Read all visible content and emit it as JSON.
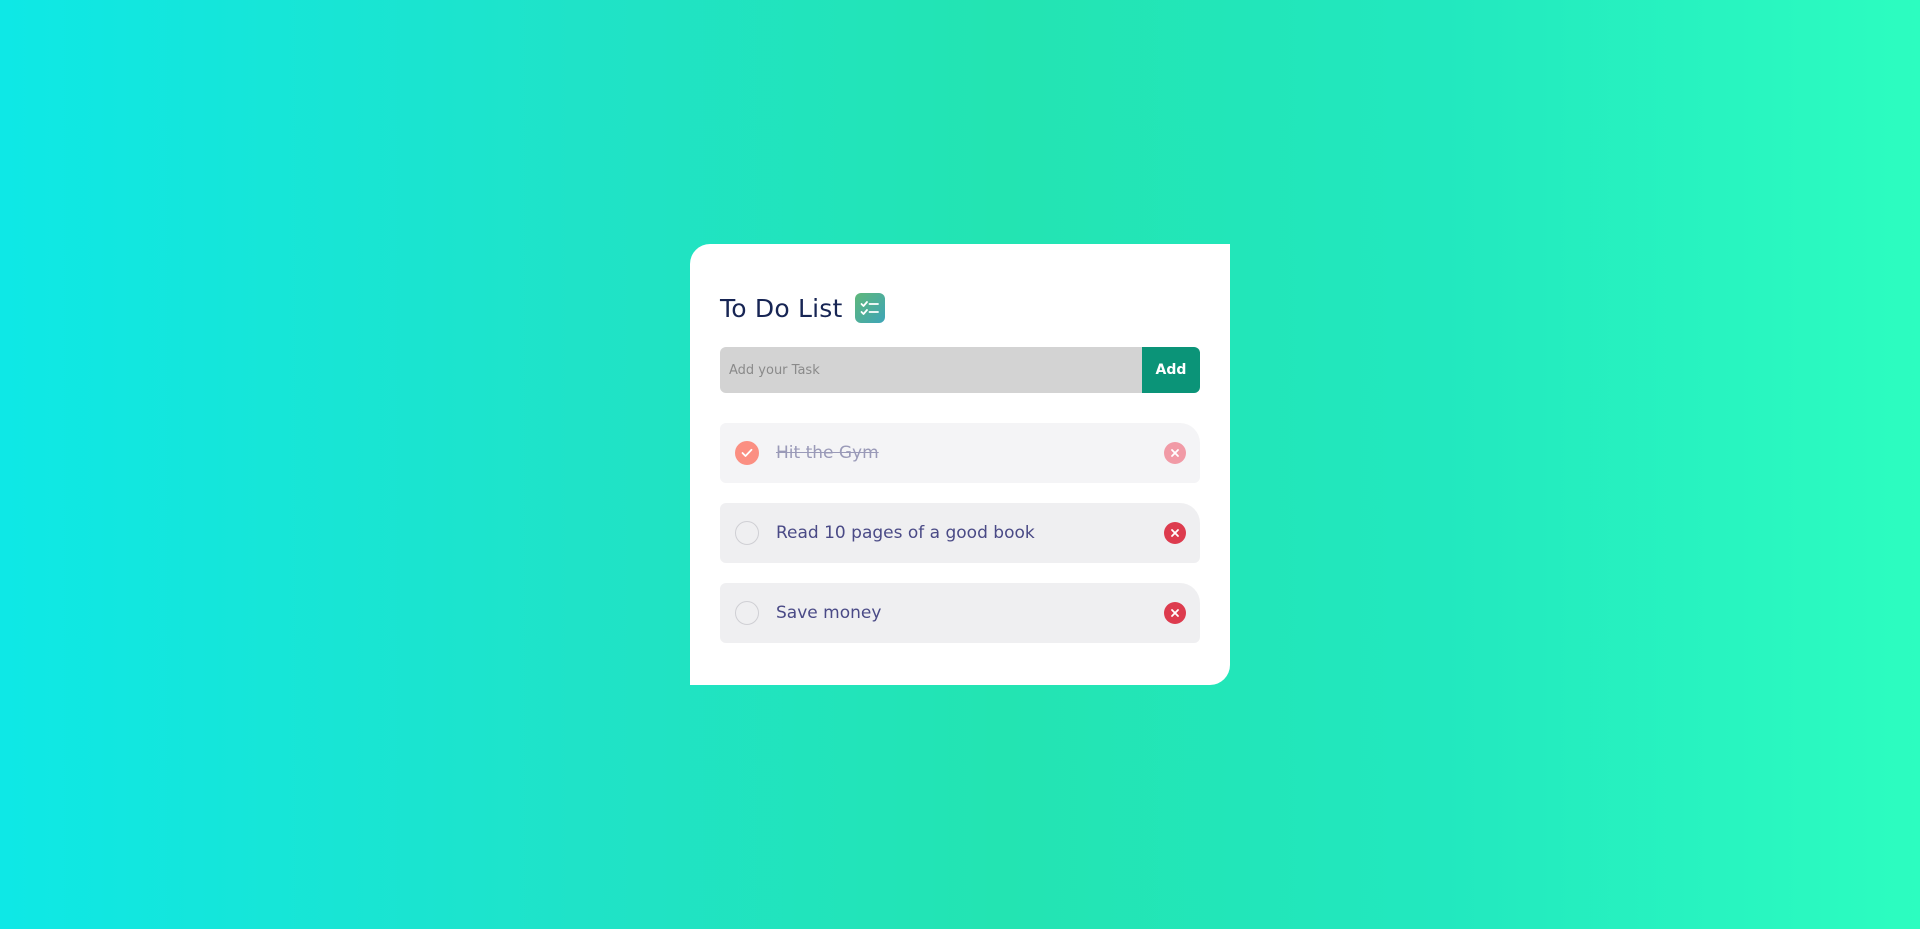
{
  "app": {
    "title": "To Do List",
    "title_icon": "checklist-icon"
  },
  "input": {
    "placeholder": "Add your Task",
    "value": "",
    "add_label": "Add"
  },
  "tasks": [
    {
      "text": "Hit the Gym",
      "done": true
    },
    {
      "text": "Read 10 pages of a good book",
      "done": false
    },
    {
      "text": "Save money",
      "done": false
    }
  ],
  "colors": {
    "accent": "#0b9478",
    "title": "#172554",
    "task_text": "#4a4a86",
    "checked": "#fb8f82",
    "delete": "#dd3b4e",
    "background_left": "#0ee8e6",
    "background_right": "#2cfdc0"
  }
}
